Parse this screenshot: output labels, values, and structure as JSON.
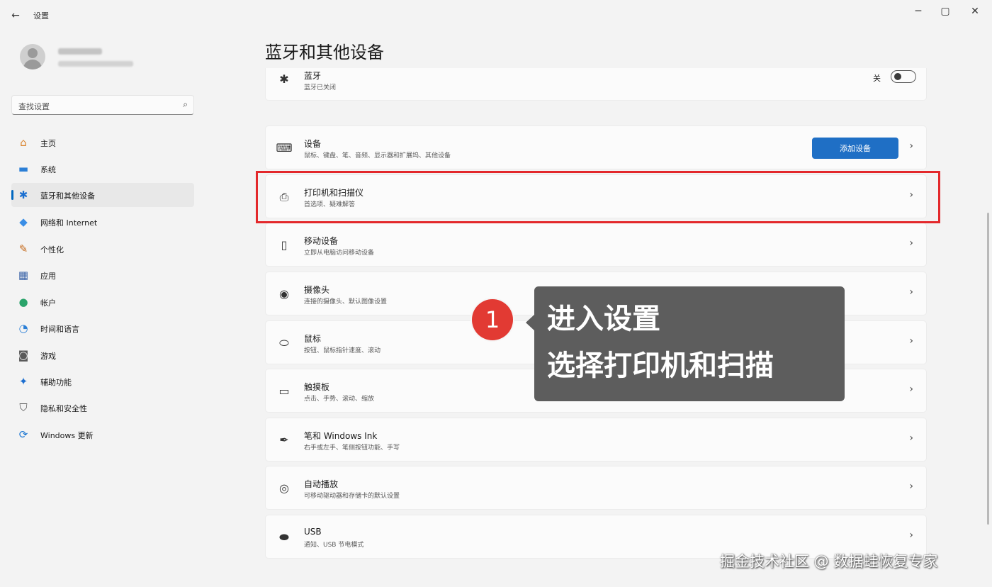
{
  "window": {
    "title": "设置",
    "back_icon": "←",
    "minimize_icon": "─",
    "maximize_icon": "▢",
    "close_icon": "✕"
  },
  "search": {
    "placeholder": "查找设置",
    "icon": "⌕"
  },
  "sidebar": {
    "items": [
      {
        "label": "主页",
        "icon": "⌂",
        "icon_color": "#d9822b"
      },
      {
        "label": "系统",
        "icon": "▬",
        "icon_color": "#2b7fd6"
      },
      {
        "label": "蓝牙和其他设备",
        "icon": "✱",
        "icon_color": "#1b6fd0",
        "active": true
      },
      {
        "label": "网络和 Internet",
        "icon": "◆",
        "icon_color": "#3a8ee6"
      },
      {
        "label": "个性化",
        "icon": "✎",
        "icon_color": "#c56a1c"
      },
      {
        "label": "应用",
        "icon": "▦",
        "icon_color": "#3b64a8"
      },
      {
        "label": "帐户",
        "icon": "●",
        "icon_color": "#2aa36a"
      },
      {
        "label": "时间和语言",
        "icon": "◔",
        "icon_color": "#2b7fd6"
      },
      {
        "label": "游戏",
        "icon": "◙",
        "icon_color": "#5a5a5a"
      },
      {
        "label": "辅助功能",
        "icon": "✦",
        "icon_color": "#1d6fd0"
      },
      {
        "label": "隐私和安全性",
        "icon": "⛉",
        "icon_color": "#5a5a5a"
      },
      {
        "label": "Windows 更新",
        "icon": "⟳",
        "icon_color": "#1b76d2"
      }
    ]
  },
  "main": {
    "title": "蓝牙和其他设备",
    "bluetooth": {
      "title": "蓝牙",
      "subtitle": "蓝牙已关闭",
      "toggle_label": "关",
      "icon": "✱"
    },
    "cards": [
      {
        "title": "设备",
        "subtitle": "鼠标、键盘、笔、音频、显示器和扩展坞、其他设备",
        "icon": "⌨",
        "button": "添加设备"
      },
      {
        "title": "打印机和扫描仪",
        "subtitle": "首选项、疑难解答",
        "icon": "⎙"
      },
      {
        "title": "移动设备",
        "subtitle": "立即从电脑访问移动设备",
        "icon": "▯"
      },
      {
        "title": "摄像头",
        "subtitle": "连接的摄像头、默认图像设置",
        "icon": "◉"
      },
      {
        "title": "鼠标",
        "subtitle": "按钮、鼠标指针速度、滚动",
        "icon": "⬭"
      },
      {
        "title": "触摸板",
        "subtitle": "点击、手势、滚动、缩放",
        "icon": "▭"
      },
      {
        "title": "笔和 Windows Ink",
        "subtitle": "右手或左手、笔侧按钮功能、手写",
        "icon": "✒"
      },
      {
        "title": "自动播放",
        "subtitle": "可移动驱动器和存储卡的默认设置",
        "icon": "◎"
      },
      {
        "title": "USB",
        "subtitle": "通知、USB 节电模式",
        "icon": "⬬"
      }
    ],
    "chevron": "›"
  },
  "annotation": {
    "badge": "1",
    "line1": "进入设置",
    "line2": "选择打印机和扫描"
  },
  "watermark": "掘金技术社区 @ 数据蛙恢复专家"
}
